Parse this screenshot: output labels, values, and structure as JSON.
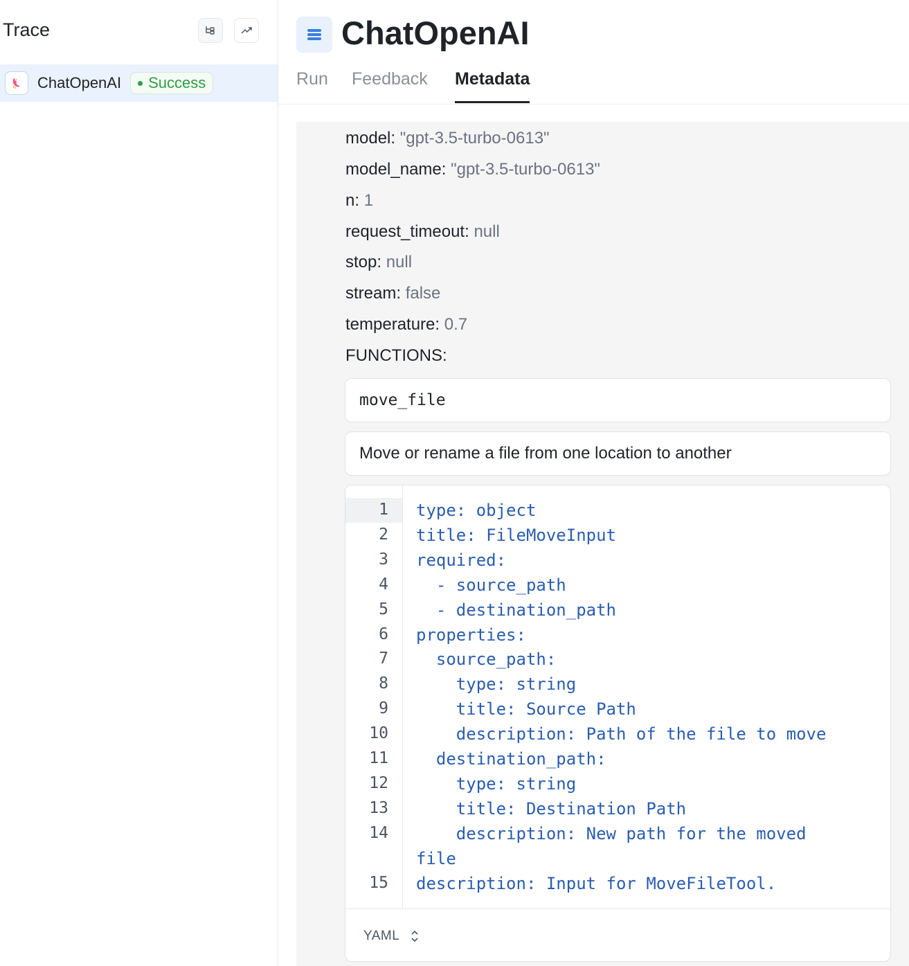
{
  "sidebar": {
    "title": "Trace",
    "run": {
      "name": "ChatOpenAI",
      "status": "Success"
    }
  },
  "main": {
    "title": "ChatOpenAI",
    "tabs": [
      {
        "label": "Run"
      },
      {
        "label": "Feedback"
      },
      {
        "label": "Metadata"
      }
    ],
    "active_tab": "Metadata"
  },
  "metadata": {
    "fields": [
      {
        "key": "model:",
        "value": "\"gpt-3.5-turbo-0613\""
      },
      {
        "key": "model_name:",
        "value": "\"gpt-3.5-turbo-0613\""
      },
      {
        "key": "n:",
        "value": "1"
      },
      {
        "key": "request_timeout:",
        "value": "null"
      },
      {
        "key": "stop:",
        "value": "null"
      },
      {
        "key": "stream:",
        "value": "false"
      },
      {
        "key": "temperature:",
        "value": "0.7"
      }
    ],
    "functions_label": "FUNCTIONS:",
    "function": {
      "name": "move_file",
      "description": "Move or rename a file from one location to another"
    },
    "code": {
      "language": "YAML",
      "lines": [
        {
          "no": "1",
          "text": "type: object"
        },
        {
          "no": "2",
          "text": "title: FileMoveInput"
        },
        {
          "no": "3",
          "text": "required:"
        },
        {
          "no": "4",
          "text": "  - source_path"
        },
        {
          "no": "5",
          "text": "  - destination_path"
        },
        {
          "no": "6",
          "text": "properties:"
        },
        {
          "no": "7",
          "text": "  source_path:"
        },
        {
          "no": "8",
          "text": "    type: string"
        },
        {
          "no": "9",
          "text": "    title: Source Path"
        },
        {
          "no": "10",
          "text": "    description: Path of the file to move"
        },
        {
          "no": "11",
          "text": "  destination_path:"
        },
        {
          "no": "12",
          "text": "    type: string"
        },
        {
          "no": "13",
          "text": "    title: Destination Path"
        },
        {
          "no": "14",
          "text": "    description: New path for the moved"
        },
        {
          "no": "",
          "text": "file"
        },
        {
          "no": "15",
          "text": "description: Input for MoveFileTool."
        }
      ]
    }
  }
}
